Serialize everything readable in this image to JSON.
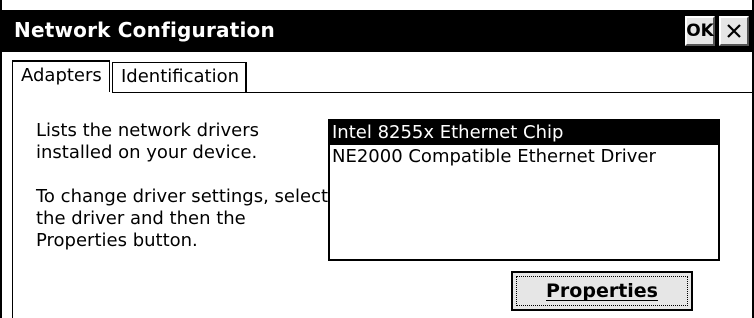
{
  "window": {
    "title": "Network Configuration",
    "ok_label": "OK"
  },
  "tabs": [
    {
      "label": "Adapters",
      "active": true
    },
    {
      "label": "Identification",
      "active": false
    }
  ],
  "description": {
    "line1": "Lists the network drivers installed on your device.",
    "line2": "To change driver settings, select the driver and then the Properties button."
  },
  "drivers": [
    {
      "label": "Intel 8255x Ethernet Chip",
      "selected": true
    },
    {
      "label": "NE2000 Compatible Ethernet Driver",
      "selected": false
    }
  ],
  "properties_button": {
    "label": "Properties"
  },
  "icons": {
    "close": "close-icon"
  }
}
